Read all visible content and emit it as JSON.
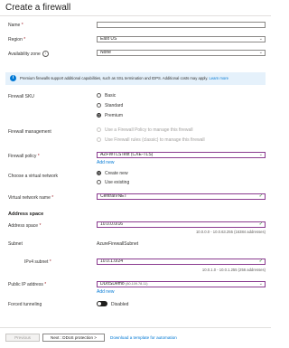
{
  "page": {
    "title": "Create a firewall"
  },
  "fields": {
    "name": {
      "label": "Name",
      "required": "*",
      "value": ""
    },
    "region": {
      "label": "Region",
      "required": "*",
      "value": "East US"
    },
    "availability_zone": {
      "label": "Availability zone",
      "value": "None"
    }
  },
  "info_banner": {
    "text": "Premium firewalls support additional capabilities, such as SSL termination and IDPS. Additional costs may apply.",
    "link": "Learn more"
  },
  "firewall_sku": {
    "label": "Firewall SKU",
    "options": [
      "Basic",
      "Standard",
      "Premium"
    ],
    "selected": "Premium"
  },
  "firewall_management": {
    "label": "Firewall management",
    "options": [
      "Use a Firewall Policy to manage this firewall",
      "Use Firewall rules (classic) to manage this firewall"
    ],
    "selected": "Use a Firewall Policy to manage this firewall"
  },
  "firewall_policy": {
    "label": "Firewall policy",
    "required": "*",
    "value": "AZFWTLSTest (CXE-TLS)",
    "add_new": "Add new"
  },
  "virtual_network": {
    "label": "Choose a virtual network",
    "options": [
      "Create new",
      "Use existing"
    ],
    "selected": "Create new"
  },
  "vnet_name": {
    "label": "Virtual network name",
    "required": "*",
    "value": "CentralVNET"
  },
  "address_space": {
    "section": "Address space",
    "label": "Address space",
    "required": "*",
    "value": "10.0.0.0/16",
    "hint": "10.0.0.0 - 10.0.63.255 (16384 addresses)"
  },
  "subnet": {
    "label": "Subnet",
    "value": "AzureFirewallSubnet"
  },
  "ipv4_subnet": {
    "label": "IPv4 subnet",
    "required": "*",
    "value": "10.0.1.0/24",
    "hint": "10.0.1.0 - 10.0.1.255 (256 addresses)"
  },
  "public_ip": {
    "label": "Public IP address",
    "required": "*",
    "value": "DDoSDemo",
    "value_suffix": "(80.109.78.11)",
    "add_new": "Add new"
  },
  "forced_tunneling": {
    "label": "Forced tunneling",
    "state": "Disabled"
  },
  "footer": {
    "previous": "Previous",
    "next": "Next : DDoS protection >",
    "download": "Download a template for automation"
  }
}
